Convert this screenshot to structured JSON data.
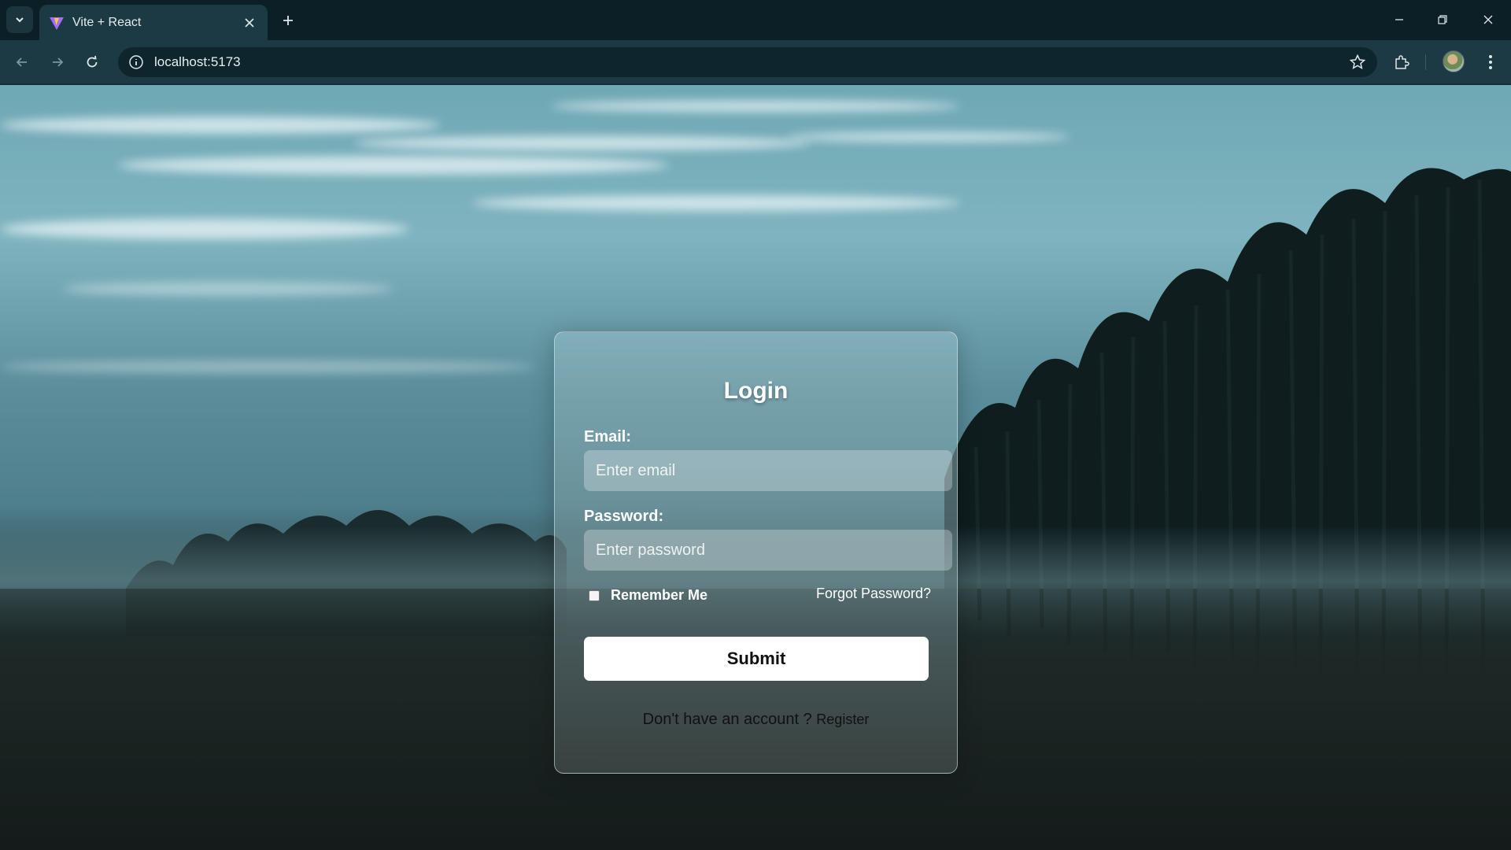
{
  "browser": {
    "tab_title": "Vite + React",
    "url": "localhost:5173"
  },
  "login": {
    "title": "Login",
    "email_label": "Email:",
    "email_placeholder": "Enter email",
    "password_label": "Password:",
    "password_placeholder": "Enter password",
    "remember_label": "Remember Me",
    "forgot_label": "Forgot Password?",
    "submit_label": "Submit",
    "no_account_text": "Don't have an account ? ",
    "register_label": "Register"
  },
  "colors": {
    "chrome_dark": "#0c1f27",
    "chrome_tab": "#1b3a44",
    "button_bg": "#ffffff"
  }
}
